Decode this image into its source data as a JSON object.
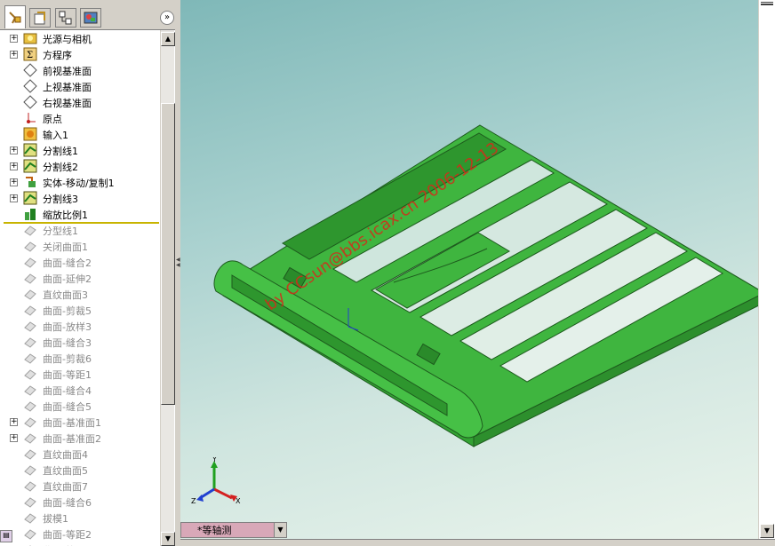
{
  "tabs": [
    {
      "name": "feature-manager-tab",
      "icon": "feature-tree-icon"
    },
    {
      "name": "property-manager-tab",
      "icon": "property-icon"
    },
    {
      "name": "configuration-manager-tab",
      "icon": "configuration-icon"
    },
    {
      "name": "display-manager-tab",
      "icon": "appearance-icon"
    }
  ],
  "expand_glyph": "»",
  "tree": [
    {
      "label": "光源与相机",
      "icon": "lights-cameras-icon",
      "expandable": true,
      "suppressed": false
    },
    {
      "label": "方程序",
      "icon": "equations-icon",
      "expandable": true,
      "suppressed": false
    },
    {
      "label": "前视基准面",
      "icon": "plane-icon",
      "expandable": false,
      "suppressed": false
    },
    {
      "label": "上视基准面",
      "icon": "plane-icon",
      "expandable": false,
      "suppressed": false
    },
    {
      "label": "右视基准面",
      "icon": "plane-icon",
      "expandable": false,
      "suppressed": false
    },
    {
      "label": "原点",
      "icon": "origin-icon",
      "expandable": false,
      "suppressed": false
    },
    {
      "label": "输入1",
      "icon": "imported-body-icon",
      "expandable": false,
      "suppressed": false
    },
    {
      "label": "分割线1",
      "icon": "split-line-icon",
      "expandable": true,
      "suppressed": false
    },
    {
      "label": "分割线2",
      "icon": "split-line-icon",
      "expandable": true,
      "suppressed": false
    },
    {
      "label": "实体-移动/复制1",
      "icon": "move-copy-body-icon",
      "expandable": true,
      "suppressed": false
    },
    {
      "label": "分割线3",
      "icon": "split-line-icon",
      "expandable": true,
      "suppressed": false
    },
    {
      "label": "缩放比例1",
      "icon": "scale-icon",
      "expandable": false,
      "suppressed": false
    },
    {
      "label": "分型线1",
      "icon": "parting-line-icon",
      "expandable": false,
      "suppressed": true
    },
    {
      "label": "关闭曲面1",
      "icon": "shut-off-surface-icon",
      "expandable": false,
      "suppressed": true
    },
    {
      "label": "曲面-缝合2",
      "icon": "knit-surface-icon",
      "expandable": false,
      "suppressed": true
    },
    {
      "label": "曲面-延伸2",
      "icon": "extend-surface-icon",
      "expandable": false,
      "suppressed": true
    },
    {
      "label": "直纹曲面3",
      "icon": "ruled-surface-icon",
      "expandable": false,
      "suppressed": true
    },
    {
      "label": "曲面-剪裁5",
      "icon": "trim-surface-icon",
      "expandable": false,
      "suppressed": true
    },
    {
      "label": "曲面-放样3",
      "icon": "loft-surface-icon",
      "expandable": false,
      "suppressed": true
    },
    {
      "label": "曲面-缝合3",
      "icon": "knit-surface-icon",
      "expandable": false,
      "suppressed": true
    },
    {
      "label": "曲面-剪裁6",
      "icon": "trim-surface-icon",
      "expandable": false,
      "suppressed": true
    },
    {
      "label": "曲面-等距1",
      "icon": "offset-surface-icon",
      "expandable": false,
      "suppressed": true
    },
    {
      "label": "曲面-缝合4",
      "icon": "knit-surface-icon",
      "expandable": false,
      "suppressed": true
    },
    {
      "label": "曲面-缝合5",
      "icon": "knit-surface-icon",
      "expandable": false,
      "suppressed": true
    },
    {
      "label": "曲面-基准面1",
      "icon": "planar-surface-icon",
      "expandable": true,
      "suppressed": true
    },
    {
      "label": "曲面-基准面2",
      "icon": "planar-surface-icon",
      "expandable": true,
      "suppressed": true
    },
    {
      "label": "直纹曲面4",
      "icon": "ruled-surface-icon",
      "expandable": false,
      "suppressed": true
    },
    {
      "label": "直纹曲面5",
      "icon": "ruled-surface-icon",
      "expandable": false,
      "suppressed": true
    },
    {
      "label": "直纹曲面7",
      "icon": "ruled-surface-icon",
      "expandable": false,
      "suppressed": true
    },
    {
      "label": "曲面-缝合6",
      "icon": "knit-surface-icon",
      "expandable": false,
      "suppressed": true
    },
    {
      "label": "拔模1",
      "icon": "draft-icon",
      "expandable": false,
      "suppressed": true
    },
    {
      "label": "曲面-等距2",
      "icon": "offset-surface-icon",
      "expandable": false,
      "suppressed": true
    },
    {
      "label": "曲面-等距3",
      "icon": "offset-surface-icon",
      "expandable": false,
      "suppressed": true
    }
  ],
  "watermark": "by CCsun@bbs.icax.cn 2006-12-13",
  "view_orientation": "*等轴测",
  "triad": {
    "x": "X",
    "y": "Y",
    "z": "Z"
  },
  "colors": {
    "model": "#3fb53f",
    "model_dark": "#2a8a2a",
    "x_axis": "#d42020",
    "y_axis": "#20a020",
    "z_axis": "#2040d0",
    "watermark": "#d62a1a"
  }
}
